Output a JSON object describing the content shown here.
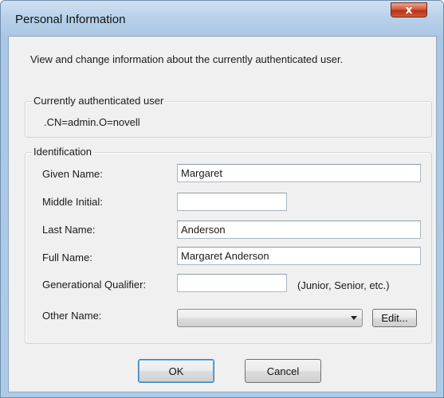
{
  "window": {
    "title": "Personal Information",
    "close_label": "x"
  },
  "intro": "View and change information about the currently authenticated user.",
  "current_user": {
    "legend": "Currently authenticated user",
    "value": ".CN=admin.O=novell"
  },
  "identification": {
    "legend": "Identification",
    "given_name": {
      "label": "Given Name:",
      "value": "Margaret"
    },
    "middle_initial": {
      "label": "Middle Initial:",
      "value": ""
    },
    "last_name": {
      "label": "Last Name:",
      "value": "Anderson"
    },
    "full_name": {
      "label": "Full Name:",
      "value": "Margaret Anderson"
    },
    "generational_qualifier": {
      "label": "Generational Qualifier:",
      "value": "",
      "hint": "(Junior, Senior, etc.)"
    },
    "other_name": {
      "label": "Other Name:",
      "value": "",
      "edit_label": "Edit..."
    }
  },
  "buttons": {
    "ok": "OK",
    "cancel": "Cancel"
  }
}
